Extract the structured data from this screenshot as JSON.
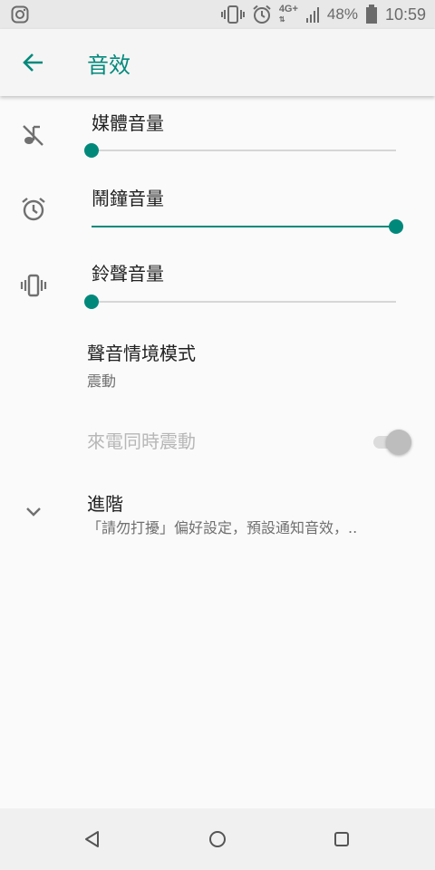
{
  "status_bar": {
    "battery_text": "48%",
    "time": "10:59",
    "network": "4G+",
    "icons": [
      "instagram-icon",
      "vibrate-icon",
      "alarm-icon",
      "network-4g-icon",
      "signal-icon",
      "battery-icon"
    ]
  },
  "app_bar": {
    "title": "音效",
    "back_icon": "back-arrow-icon"
  },
  "sliders": [
    {
      "label": "媒體音量",
      "value": 0.0,
      "icon": "music-off-icon"
    },
    {
      "label": "鬧鐘音量",
      "value": 1.0,
      "icon": "alarm-icon"
    },
    {
      "label": "鈴聲音量",
      "value": 0.0,
      "icon": "vibrate-icon"
    }
  ],
  "sound_mode": {
    "title": "聲音情境模式",
    "summary": "震動"
  },
  "vibrate_when_ringing": {
    "title": "來電同時震動",
    "enabled": false,
    "checked": true
  },
  "advanced": {
    "title": "進階",
    "summary": "「請勿打擾」偏好設定，預設通知音效，..",
    "icon": "chevron-down-icon"
  },
  "nav_bar": {
    "icons": [
      "back-triangle-icon",
      "home-circle-icon",
      "recents-square-icon"
    ]
  },
  "colors": {
    "accent": "#00897b",
    "background": "#fafafa",
    "status_bar": "#e8e8e8",
    "disabled_text": "#b7b7b7"
  }
}
